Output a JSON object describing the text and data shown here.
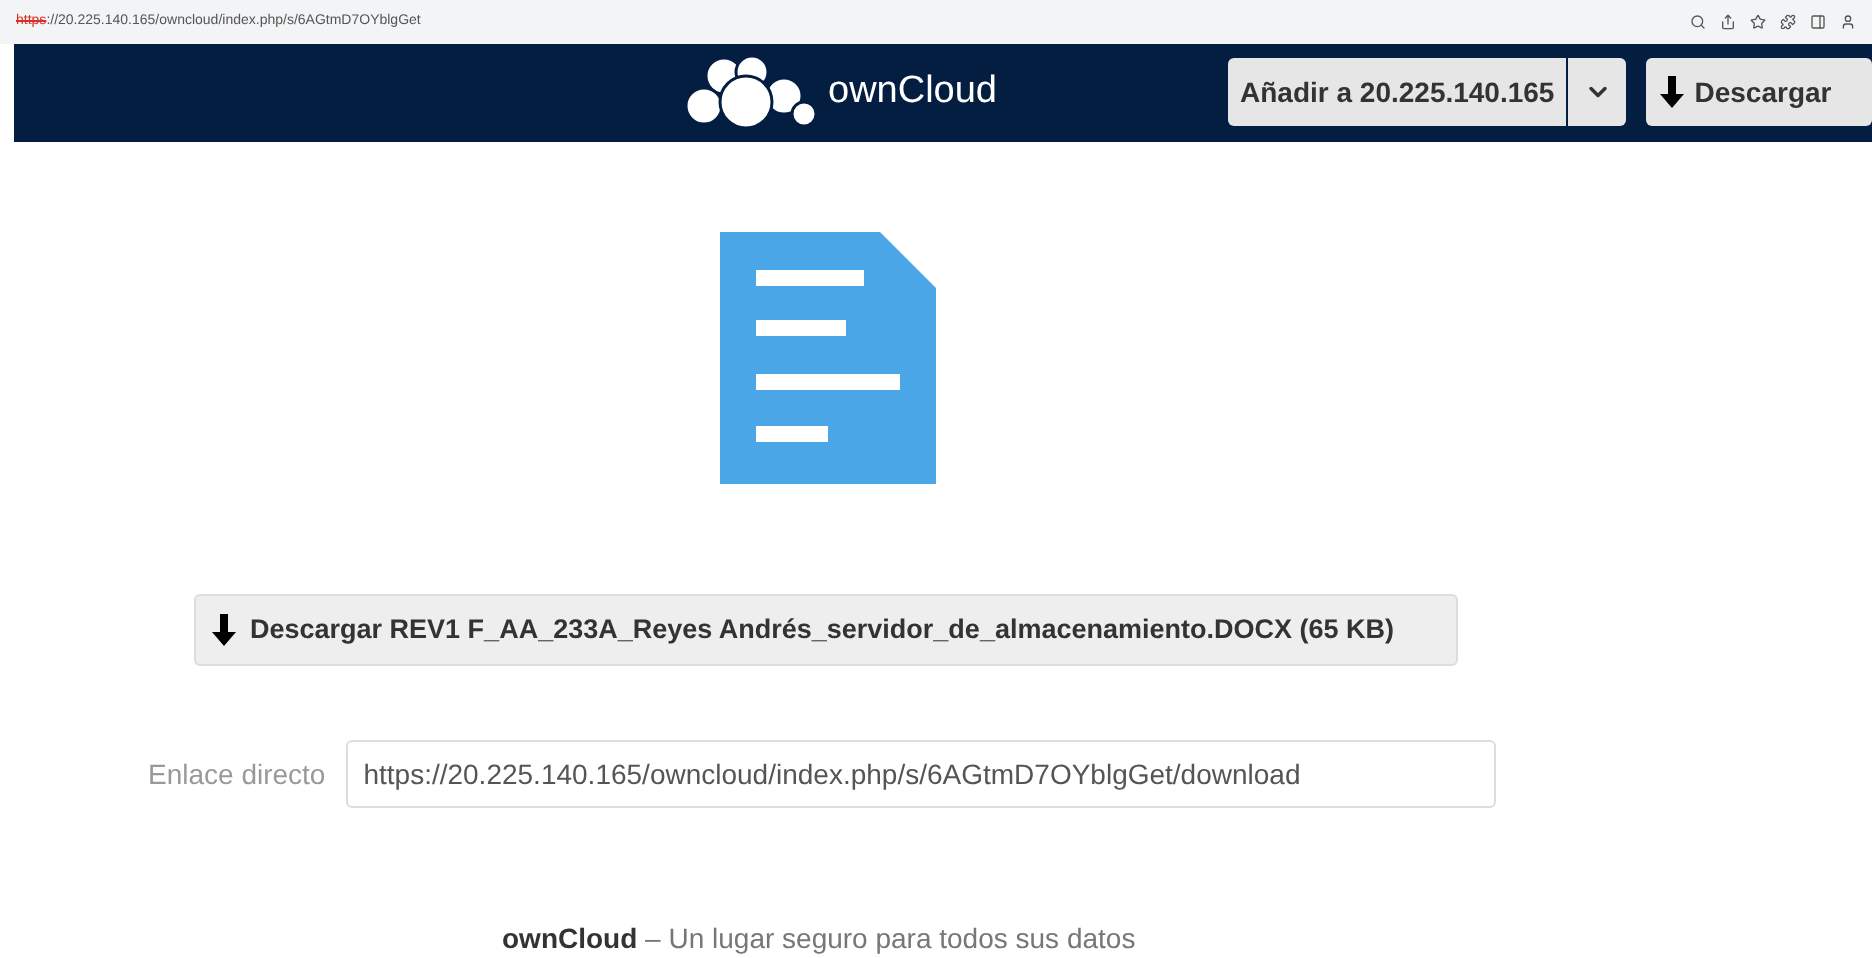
{
  "browser": {
    "url_scheme": "https",
    "url_rest": "://20.225.140.165/owncloud/index.php/s/6AGtmD7OYblgGet"
  },
  "header": {
    "brand": "ownCloud",
    "add_button": "Añadir a 20.225.140.165",
    "download_button": "Descargar"
  },
  "download": {
    "label": "Descargar REV1 F_AA_233A_Reyes Andrés_servidor_de_almacenamiento.DOCX (65 KB)"
  },
  "direct_link": {
    "label": "Enlace directo",
    "value": "https://20.225.140.165/owncloud/index.php/s/6AGtmD7OYblgGet/download"
  },
  "footer": {
    "brand": "ownCloud",
    "tagline": " – Un lugar seguro para todos sus datos"
  }
}
